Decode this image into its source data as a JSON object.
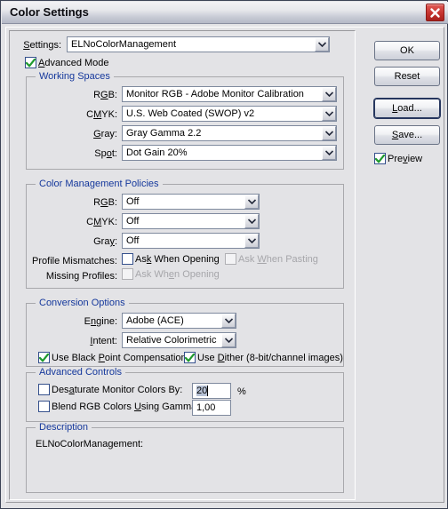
{
  "window": {
    "title": "Color Settings",
    "close_label": "Close"
  },
  "settings_row": {
    "label": "Settings:",
    "value": "ELNoColorManagement"
  },
  "advanced_mode": {
    "label": "Advanced Mode",
    "checked": true
  },
  "working_spaces": {
    "legend": "Working Spaces",
    "rows": [
      {
        "label": "RGB:",
        "value": "Monitor RGB - Adobe Monitor Calibration"
      },
      {
        "label": "CMYK:",
        "value": "U.S. Web Coated (SWOP) v2"
      },
      {
        "label": "Gray:",
        "value": "Gray Gamma 2.2"
      },
      {
        "label": "Spot:",
        "value": "Dot Gain 20%"
      }
    ]
  },
  "color_management_policies": {
    "legend": "Color Management Policies",
    "rows": [
      {
        "label": "RGB:",
        "value": "Off"
      },
      {
        "label": "CMYK:",
        "value": "Off"
      },
      {
        "label": "Gray:",
        "value": "Off"
      }
    ],
    "profile_mismatches_label": "Profile Mismatches:",
    "missing_profiles_label": "Missing Profiles:",
    "ask_when_opening_label": "Ask When Opening",
    "ask_when_pasting_label": "Ask When Pasting",
    "missing_ask_when_opening_label": "Ask When Opening"
  },
  "conversion_options": {
    "legend": "Conversion Options",
    "engine_label": "Engine:",
    "engine_value": "Adobe (ACE)",
    "intent_label": "Intent:",
    "intent_value": "Relative Colorimetric",
    "black_point_label": "Use Black Point Compensation",
    "dither_label": "Use Dither (8-bit/channel images)"
  },
  "advanced_controls": {
    "legend": "Advanced Controls",
    "desaturate_label": "Desaturate Monitor Colors By:",
    "desaturate_value": "20",
    "percent_label": "%",
    "blend_label": "Blend RGB Colors Using Gamma:",
    "blend_value": "1,00"
  },
  "description": {
    "legend": "Description",
    "body": "ELNoColorManagement:"
  },
  "buttons": {
    "ok": "OK",
    "reset": "Reset",
    "load": "Load...",
    "save": "Save..."
  },
  "preview": {
    "label": "Preview",
    "checked": true
  },
  "colors": {
    "dialog_bg": "#e3e3e6",
    "legend_blue": "#15389c",
    "checkbox_border": "#35508c",
    "check_green": "#1f9a2e",
    "close_red": "#c6332e",
    "disabled_text": "#a6a6aa"
  }
}
